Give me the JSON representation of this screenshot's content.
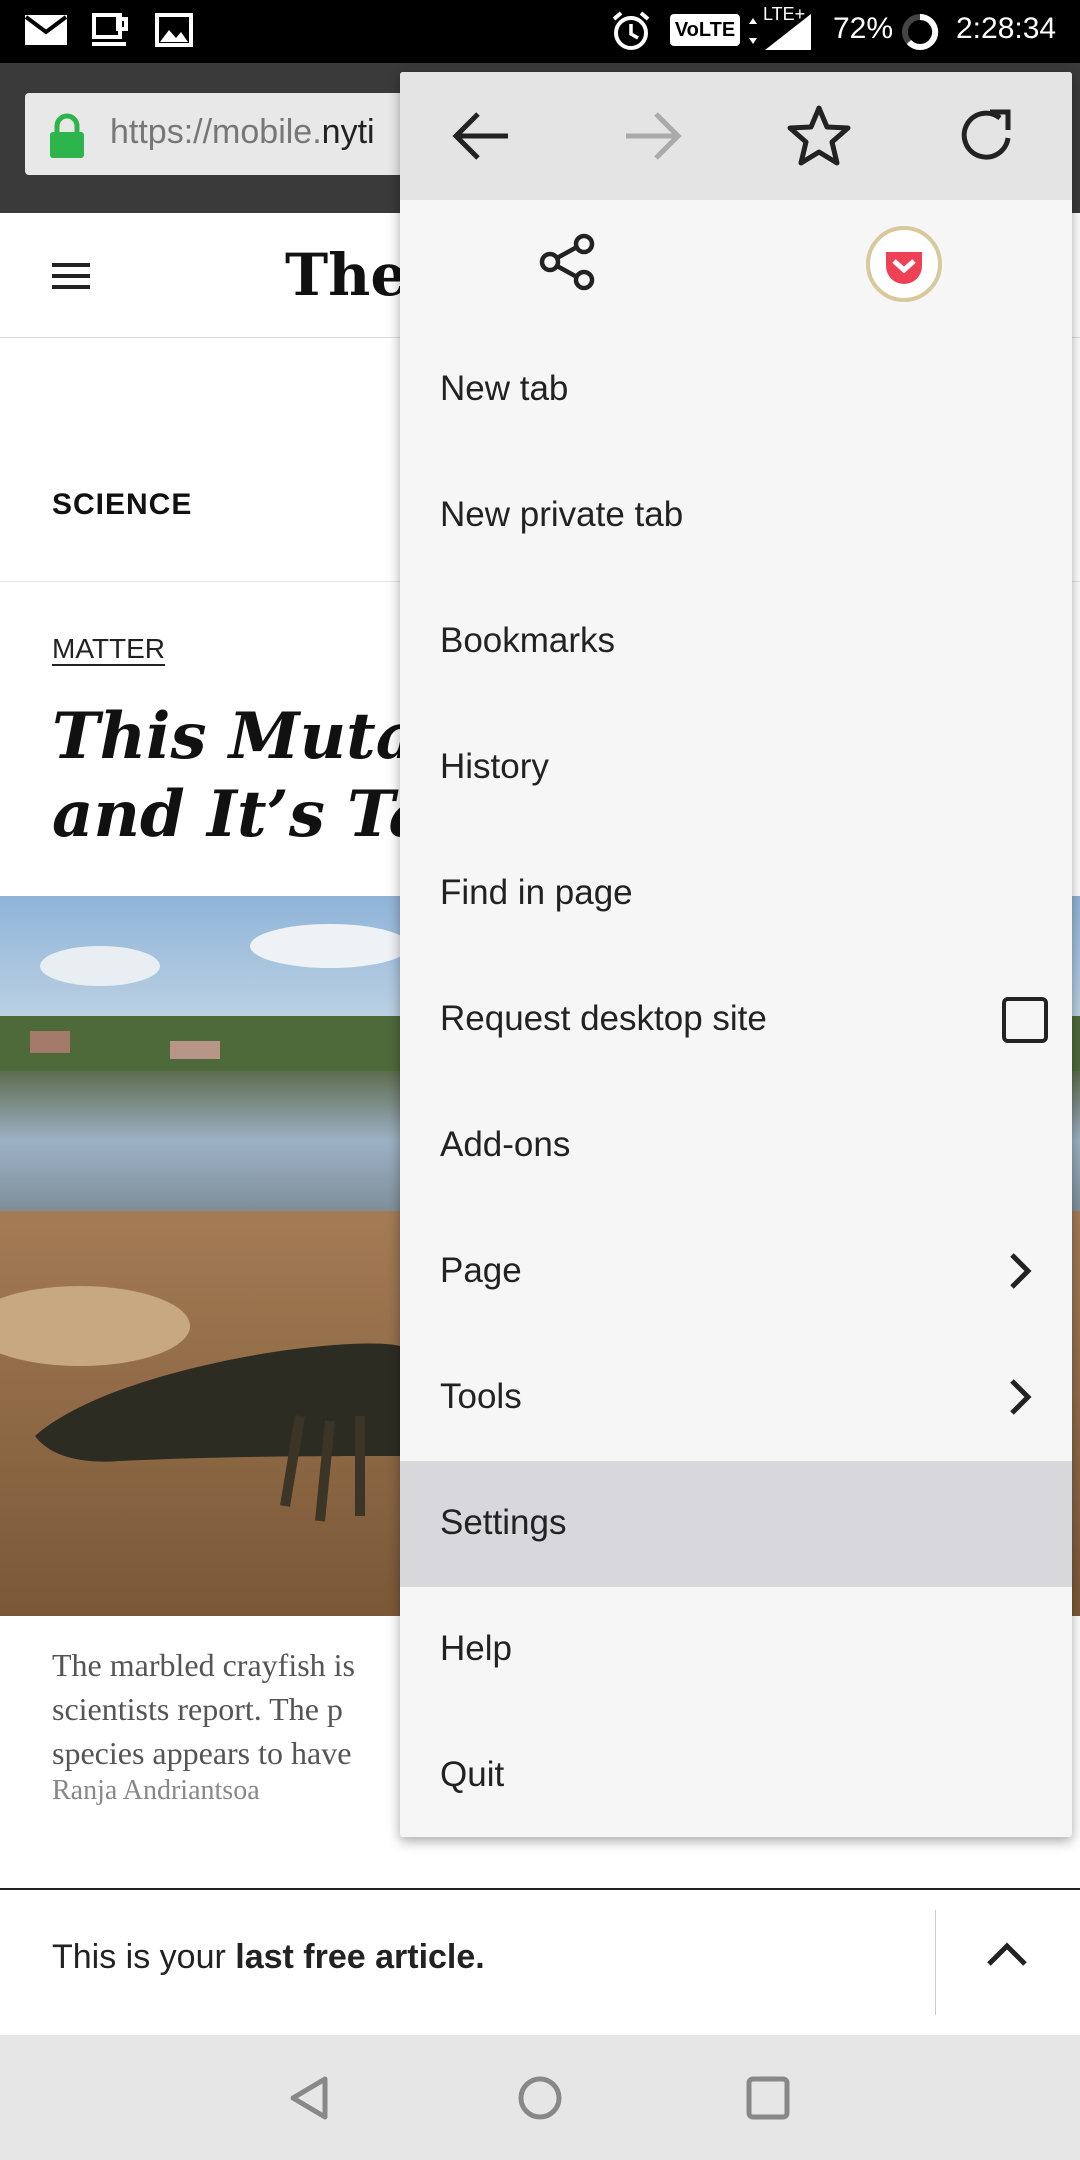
{
  "status_bar": {
    "battery": "72%",
    "time": "2:28:34",
    "volte": "VoLTE",
    "lte": "LTE+"
  },
  "browser": {
    "url_prefix": "https://mobile.",
    "url_host": "nyti"
  },
  "article": {
    "logo": "The N",
    "section": "SCIENCE",
    "kicker": "MATTER",
    "headline_line1": "This Mutant",
    "headline_line2": "and It’s Takin",
    "caption_line1": "The marbled crayfish is",
    "caption_line2": "scientists report. The p",
    "caption_line3": "species appears to have",
    "credit": "Ranja Andriantsoa"
  },
  "paywall": {
    "text_prefix": "This is your ",
    "text_bold": "last free article."
  },
  "menu": {
    "items": [
      {
        "label": "New tab"
      },
      {
        "label": "New private tab"
      },
      {
        "label": "Bookmarks"
      },
      {
        "label": "History"
      },
      {
        "label": "Find in page"
      },
      {
        "label": "Request desktop site",
        "checked": false
      },
      {
        "label": "Add-ons"
      },
      {
        "label": "Page"
      },
      {
        "label": "Tools"
      },
      {
        "label": "Settings",
        "highlighted": true
      },
      {
        "label": "Help"
      },
      {
        "label": "Quit"
      }
    ],
    "accent_pocket": "#ef4056"
  },
  "colors": {
    "lock_green": "#2db44a",
    "menu_bg": "#f6f6f6",
    "menu_top_bg": "#e4e4e4",
    "highlight": "#d8d7dc"
  }
}
